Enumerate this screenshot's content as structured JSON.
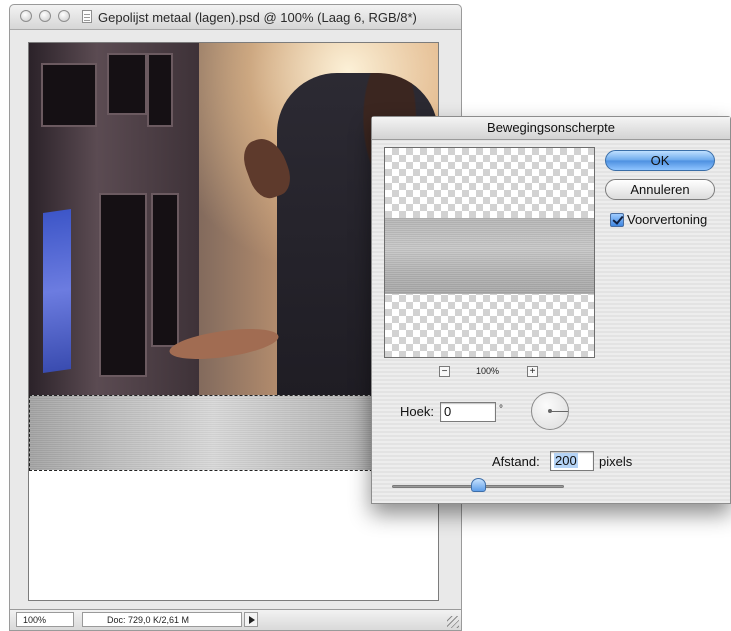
{
  "window": {
    "title": "Gepolijst metaal (lagen).psd @ 100% (Laag 6, RGB/8*)",
    "zoom": "100%",
    "doc_info": "Doc: 729,0 K/2,61 M"
  },
  "dialog": {
    "title": "Bewegingsonscherpte",
    "ok_label": "OK",
    "cancel_label": "Annuleren",
    "preview_label": "Voorvertoning",
    "preview_checked": true,
    "preview_zoom": "100%",
    "zoom_out_symbol": "−",
    "zoom_in_symbol": "+",
    "angle_label": "Hoek:",
    "angle_value": "0",
    "degree_symbol": "°",
    "distance_label": "Afstand:",
    "distance_value": "200",
    "distance_unit": "pixels",
    "distance_slider_fraction": 0.5
  },
  "icons": {
    "close": "close-circle-icon",
    "minimize": "minimize-circle-icon",
    "zoom": "zoom-circle-icon",
    "document": "document-proxy-icon",
    "status_menu": "triangle-right-icon",
    "resize": "resize-grip-icon",
    "angle_dial": "angle-dial-icon"
  },
  "colors": {
    "ok_button": "#6aa8ec",
    "checkbox": "#3f86e0",
    "selection": "#b5d3f5",
    "slider_thumb": "#5f9ee8"
  }
}
